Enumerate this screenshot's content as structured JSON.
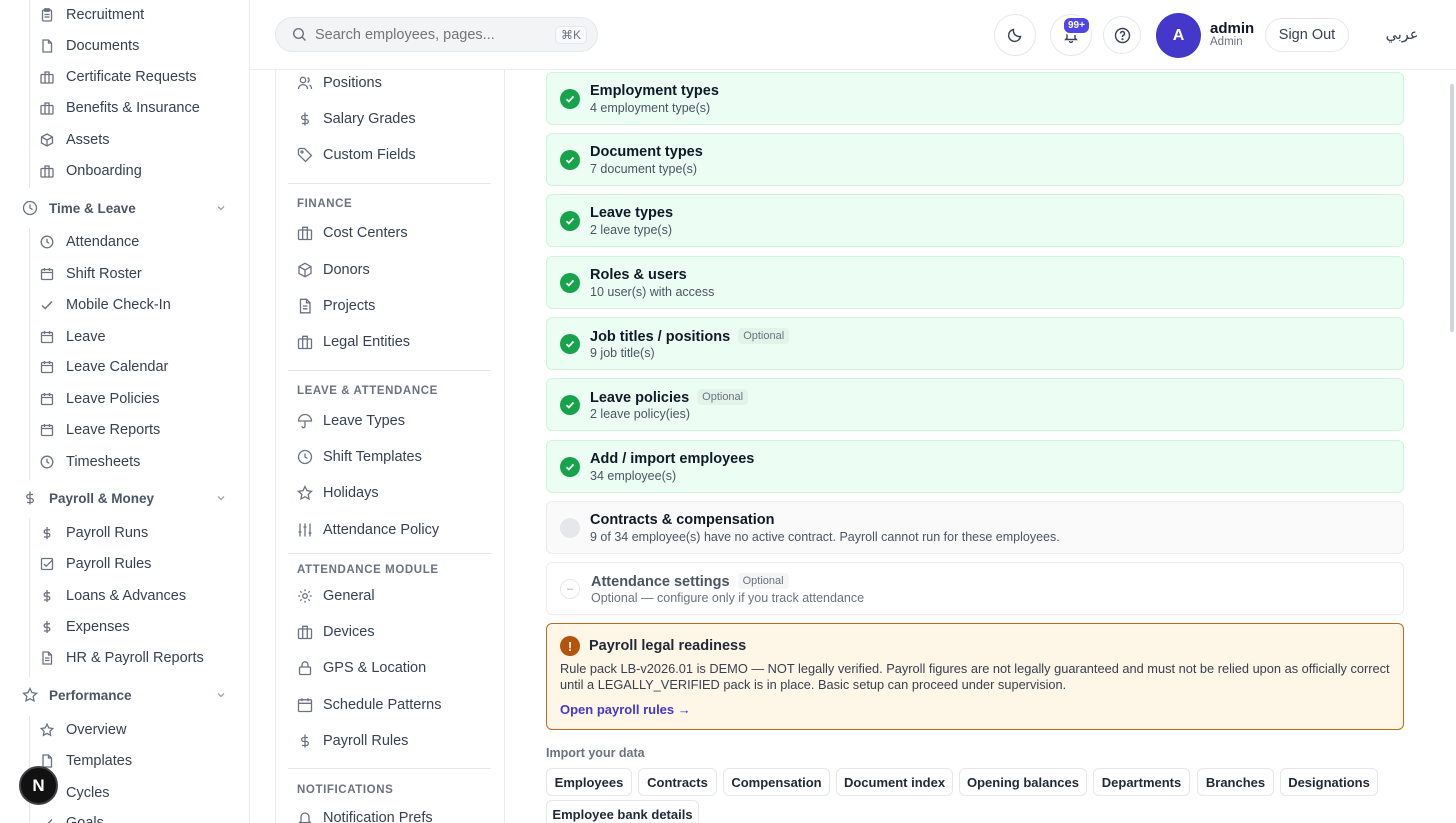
{
  "sidebar": {
    "hr_items": [
      {
        "label": "Recruitment",
        "icon": "clipboard-icon"
      },
      {
        "label": "Documents",
        "icon": "file-icon"
      },
      {
        "label": "Certificate Requests",
        "icon": "building-icon"
      },
      {
        "label": "Benefits & Insurance",
        "icon": "building-icon"
      },
      {
        "label": "Assets",
        "icon": "box-icon"
      },
      {
        "label": "Onboarding",
        "icon": "building-icon"
      }
    ],
    "time_leave": {
      "label": "Time & Leave",
      "items": [
        {
          "label": "Attendance",
          "icon": "clock-icon"
        },
        {
          "label": "Shift Roster",
          "icon": "calendar-icon"
        },
        {
          "label": "Mobile Check-In",
          "icon": "check-icon"
        },
        {
          "label": "Leave",
          "icon": "calendar-icon"
        },
        {
          "label": "Leave Calendar",
          "icon": "calendar-icon"
        },
        {
          "label": "Leave Policies",
          "icon": "calendar-icon"
        },
        {
          "label": "Leave Reports",
          "icon": "calendar-icon"
        },
        {
          "label": "Timesheets",
          "icon": "clock-icon"
        }
      ]
    },
    "payroll": {
      "label": "Payroll & Money",
      "items": [
        {
          "label": "Payroll Runs",
          "icon": "dollar-icon"
        },
        {
          "label": "Payroll Rules",
          "icon": "checkbox-icon"
        },
        {
          "label": "Loans & Advances",
          "icon": "dollar-icon"
        },
        {
          "label": "Expenses",
          "icon": "dollar-icon"
        },
        {
          "label": "HR & Payroll Reports",
          "icon": "file-icon"
        }
      ]
    },
    "performance": {
      "label": "Performance",
      "items": [
        {
          "label": "Overview",
          "icon": "star-icon"
        },
        {
          "label": "Templates",
          "icon": "file-icon"
        },
        {
          "label": "Cycles",
          "icon": "calendar-icon"
        },
        {
          "label": "Goals",
          "icon": "check-icon"
        }
      ]
    },
    "fab_label": "N"
  },
  "topbar": {
    "search_placeholder": "Search employees, pages...",
    "shortcut": "⌘K",
    "notif_badge": "99+",
    "avatar_initial": "A",
    "user_name": "admin",
    "user_role": "Admin",
    "sign_out": "Sign Out",
    "language": "عربي"
  },
  "settings_nav": {
    "top_items": [
      {
        "label": "Positions",
        "icon": "users-icon"
      },
      {
        "label": "Salary Grades",
        "icon": "dollar-icon"
      },
      {
        "label": "Custom Fields",
        "icon": "tag-icon"
      }
    ],
    "finance": {
      "title": "FINANCE",
      "items": [
        {
          "label": "Cost Centers",
          "icon": "building-icon"
        },
        {
          "label": "Donors",
          "icon": "box-icon"
        },
        {
          "label": "Projects",
          "icon": "file-icon"
        },
        {
          "label": "Legal Entities",
          "icon": "building-icon"
        }
      ]
    },
    "leave_attendance": {
      "title": "LEAVE & ATTENDANCE",
      "items": [
        {
          "label": "Leave Types",
          "icon": "umbrella-icon"
        },
        {
          "label": "Shift Templates",
          "icon": "clock-icon"
        },
        {
          "label": "Holidays",
          "icon": "star-icon"
        },
        {
          "label": "Attendance Policy",
          "icon": "sliders-icon"
        }
      ]
    },
    "attendance_module": {
      "title": "ATTENDANCE MODULE",
      "items": [
        {
          "label": "General",
          "icon": "gear-icon"
        },
        {
          "label": "Devices",
          "icon": "building-icon"
        },
        {
          "label": "GPS & Location",
          "icon": "lock-icon"
        },
        {
          "label": "Schedule Patterns",
          "icon": "calendar-icon"
        },
        {
          "label": "Payroll Rules",
          "icon": "dollar-icon"
        }
      ]
    },
    "notifications": {
      "title": "NOTIFICATIONS",
      "items": [
        {
          "label": "Notification Prefs",
          "icon": "bell-icon"
        }
      ]
    }
  },
  "checklist": [
    {
      "title": "Employment types",
      "subtitle": "4 employment type(s)",
      "status": "done",
      "optional": ""
    },
    {
      "title": "Document types",
      "subtitle": "7 document type(s)",
      "status": "done",
      "optional": ""
    },
    {
      "title": "Leave types",
      "subtitle": "2 leave type(s)",
      "status": "done",
      "optional": ""
    },
    {
      "title": "Roles & users",
      "subtitle": "10 user(s) with access",
      "status": "done",
      "optional": ""
    },
    {
      "title": "Job titles / positions",
      "subtitle": "9 job title(s)",
      "status": "done",
      "optional": "Optional"
    },
    {
      "title": "Leave policies",
      "subtitle": "2 leave policy(ies)",
      "status": "done",
      "optional": "Optional"
    },
    {
      "title": "Add / import employees",
      "subtitle": "34 employee(s)",
      "status": "done",
      "optional": ""
    },
    {
      "title": "Contracts & compensation",
      "subtitle": "9 of 34 employee(s) have no active contract. Payroll cannot run for these employees.",
      "status": "todo",
      "optional": ""
    },
    {
      "title": "Attendance settings",
      "subtitle": "Optional — configure only if you track attendance",
      "status": "optional",
      "optional": "Optional"
    }
  ],
  "legal_warning": {
    "icon": "!",
    "title": "Payroll legal readiness",
    "text": "Rule pack LB-v2026.01 is DEMO — NOT legally verified. Payroll figures are not legally guaranteed and must not be relied upon as officially correct until a LEGALLY_VERIFIED pack is in place. Basic setup can proceed under supervision.",
    "link": "Open payroll rules →"
  },
  "import": {
    "label": "Import your data",
    "chips": [
      "Employees",
      "Contracts",
      "Compensation",
      "Document index",
      "Opening balances",
      "Departments",
      "Branches",
      "Designations",
      "Employee bank details"
    ]
  }
}
